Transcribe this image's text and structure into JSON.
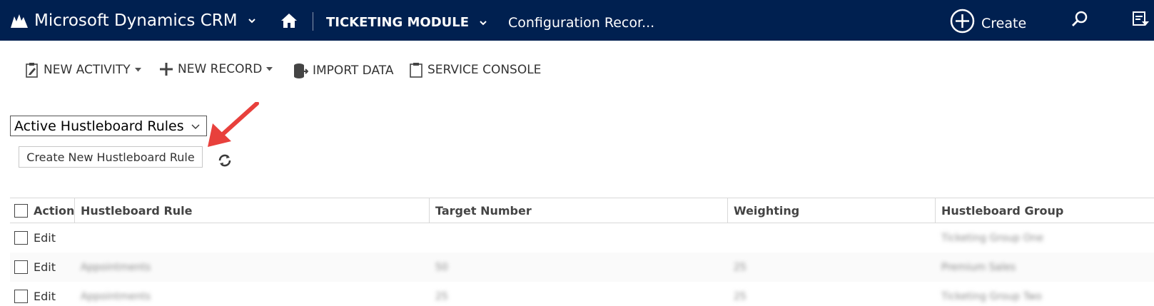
{
  "topbar": {
    "app_title": "Microsoft Dynamics CRM",
    "module": "TICKETING MODULE",
    "breadcrumb": "Configuration Recor...",
    "create_label": "Create",
    "bg_color": "#002050"
  },
  "commands": [
    {
      "label": "NEW ACTIVITY",
      "icon": "clipboard-edit-icon",
      "dropdown": true
    },
    {
      "label": "NEW RECORD",
      "icon": "plus-icon",
      "dropdown": true
    },
    {
      "label": "IMPORT DATA",
      "icon": "database-import-icon",
      "dropdown": false
    },
    {
      "label": "SERVICE CONSOLE",
      "icon": "clipboard-icon",
      "dropdown": false
    }
  ],
  "view_selector": {
    "selected": "Active Hustleboard Rules"
  },
  "create_button_label": "Create New Hustleboard Rule",
  "annotation_arrow_color": "#e8403c",
  "grid": {
    "columns": [
      "Action",
      "Hustleboard Rule",
      "Target Number",
      "Weighting",
      "Hustleboard Group"
    ],
    "rows": [
      {
        "action": "Edit",
        "rule": "",
        "target": "",
        "weighting": "",
        "group": "Ticketing Group One"
      },
      {
        "action": "Edit",
        "rule": "Appointments",
        "target": "50",
        "weighting": "25",
        "group": "Premium Sales"
      },
      {
        "action": "Edit",
        "rule": "Appointments",
        "target": "25",
        "weighting": "25",
        "group": "Ticketing Group Two"
      }
    ]
  }
}
